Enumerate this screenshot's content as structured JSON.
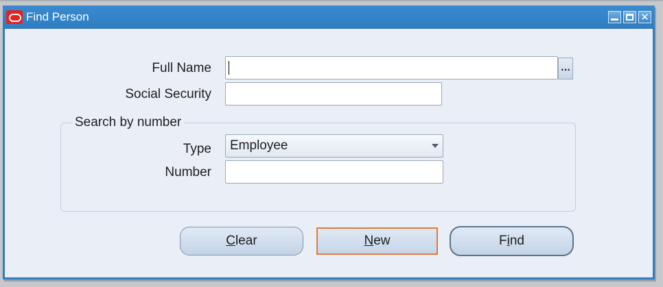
{
  "window": {
    "title": "Find Person",
    "icon": "oracle-logo-icon"
  },
  "window_controls": {
    "minimize": "minimize-icon",
    "maximize": "maximize-icon",
    "close": "close-icon"
  },
  "form": {
    "full_name_label": "Full Name",
    "full_name_value": "",
    "lov_button_label": "...",
    "ssn_label": "Social Security",
    "ssn_value": "",
    "search_group_title": "Search by number",
    "type_label": "Type",
    "type_value": "Employee",
    "number_label": "Number",
    "number_value": ""
  },
  "buttons": {
    "clear": {
      "mnemonic": "C",
      "rest": "lear"
    },
    "new": {
      "mnemonic": "N",
      "rest": "ew"
    },
    "find": {
      "before": "F",
      "mnemonic": "i",
      "rest": "nd"
    }
  },
  "colors": {
    "titlebar": "#2f7ec3",
    "window_bg": "#eaeff7",
    "focus_outline": "#e07a3a"
  }
}
